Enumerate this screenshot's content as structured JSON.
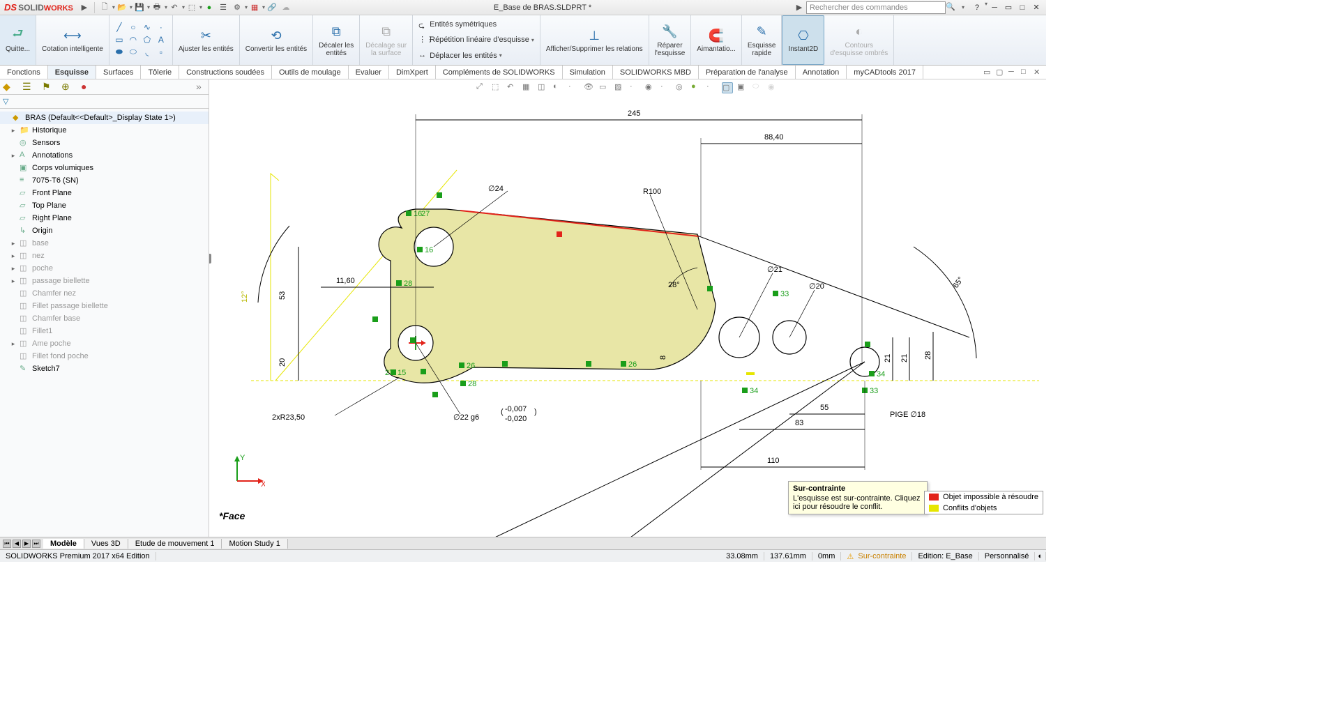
{
  "title_bar": {
    "document": "E_Base de BRAS.SLDPRT *",
    "search_placeholder": "Rechercher des commandes"
  },
  "ribbon": {
    "quitter": "Quitte...",
    "cotation": "Cotation intelligente",
    "ajuster": "Ajuster les entités",
    "convertir": "Convertir les entités",
    "decaler": "Décaler les\nentités",
    "decalage_surface": "Décalage sur\nla surface",
    "sym": "Entités symétriques",
    "rep_lin": "Répétition linéaire d'esquisse",
    "deplacer": "Déplacer les entités",
    "afficher_rel": "Afficher/Supprimer les relations",
    "reparer": "Réparer\nl'esquisse",
    "aimant": "Aimantatio...",
    "esquisse_rapide": "Esquisse\nrapide",
    "instant2d": "Instant2D",
    "contours": "Contours\nd'esquisse ombrés"
  },
  "tabs": [
    "Fonctions",
    "Esquisse",
    "Surfaces",
    "Tôlerie",
    "Constructions soudées",
    "Outils de moulage",
    "Evaluer",
    "DimXpert",
    "Compléments de SOLIDWORKS",
    "Simulation",
    "SOLIDWORKS MBD",
    "Préparation de l'analyse",
    "Annotation",
    "myCADtools 2017"
  ],
  "active_tab": "Esquisse",
  "tree": {
    "root": "BRAS  (Default<<Default>_Display State 1>)",
    "items": [
      {
        "label": "Historique",
        "icon": "folder",
        "exp": "▸"
      },
      {
        "label": "Sensors",
        "icon": "sensor",
        "exp": ""
      },
      {
        "label": "Annotations",
        "icon": "annot",
        "exp": "▸"
      },
      {
        "label": "Corps volumiques",
        "icon": "body",
        "exp": ""
      },
      {
        "label": "7075-T6 (SN)",
        "icon": "mat",
        "exp": ""
      },
      {
        "label": "Front Plane",
        "icon": "plane",
        "exp": ""
      },
      {
        "label": "Top Plane",
        "icon": "plane",
        "exp": ""
      },
      {
        "label": "Right Plane",
        "icon": "plane",
        "exp": ""
      },
      {
        "label": "Origin",
        "icon": "origin",
        "exp": ""
      },
      {
        "label": "base",
        "icon": "feat-grey",
        "exp": "▸"
      },
      {
        "label": "nez",
        "icon": "feat-grey",
        "exp": "▸"
      },
      {
        "label": "poche",
        "icon": "feat-grey",
        "exp": "▸"
      },
      {
        "label": "passage biellette",
        "icon": "feat-grey",
        "exp": "▸"
      },
      {
        "label": "Chamfer nez",
        "icon": "feat-grey",
        "exp": ""
      },
      {
        "label": "Fillet passage biellette",
        "icon": "feat-grey",
        "exp": ""
      },
      {
        "label": "Chamfer base",
        "icon": "feat-grey",
        "exp": ""
      },
      {
        "label": "Fillet1",
        "icon": "feat-grey",
        "exp": ""
      },
      {
        "label": "Ame poche",
        "icon": "feat-grey",
        "exp": "▸"
      },
      {
        "label": "Fillet fond poche",
        "icon": "feat-grey",
        "exp": ""
      },
      {
        "label": "Sketch7",
        "icon": "sketch",
        "exp": ""
      }
    ]
  },
  "dimensions": {
    "d245": "245",
    "d8840": "88,40",
    "d24": "∅24",
    "r100": "R100",
    "ang12": "12°",
    "d53": "53",
    "d1160": "11,60",
    "ang28": "28°",
    "d21": "∅21",
    "d20": "∅20",
    "ang65": "65°",
    "d20b": "20",
    "d8": "8",
    "d21r": "21",
    "d21r2": "21",
    "d28": "28",
    "r2350": "2xR23,50",
    "d22": "∅22 g6",
    "tol_up": "-0,007",
    "tol_lo": "-0,020",
    "d55": "55",
    "d83": "83",
    "pige": "PIGE ∅18",
    "d110": "110",
    "m16": "16",
    "m27": "27",
    "m28a": "28",
    "m15": "15",
    "m16b": "16",
    "m27b": "27",
    "m26": "26",
    "m26b": "26",
    "m28b": "28",
    "m33": "33",
    "m34": "34",
    "m34b": "34",
    "m33b": "33"
  },
  "canvas": {
    "face_label": "*Face"
  },
  "tooltip": {
    "title": "Sur-contrainte",
    "body": "L'esquisse est sur-contrainte. Cliquez ici pour résoudre le conflit."
  },
  "legend": {
    "red": "Objet impossible à résoudre",
    "yellow": "Conflits d'objets"
  },
  "bottom_tabs": [
    "Modèle",
    "Vues 3D",
    "Etude de mouvement 1",
    "Motion Study 1"
  ],
  "active_bottom_tab": "Modèle",
  "status": {
    "edition": "SOLIDWORKS Premium 2017 x64 Edition",
    "x": "33.08mm",
    "y": "137.61mm",
    "z": "0mm",
    "constraint": "Sur-contrainte",
    "editing": "Edition: E_Base",
    "custom": "Personnalisé"
  }
}
